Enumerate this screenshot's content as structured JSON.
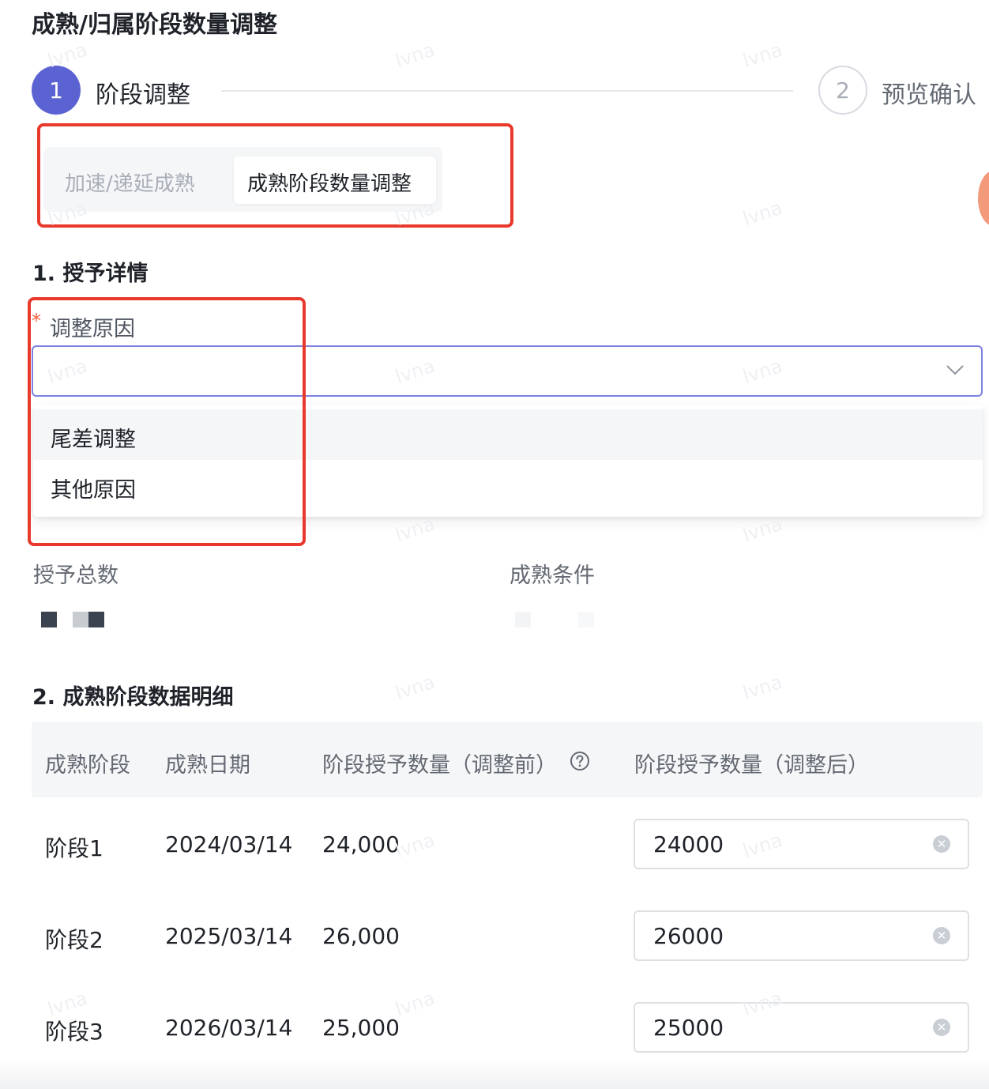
{
  "page": {
    "title": "成熟/归属阶段数量调整"
  },
  "steps": [
    {
      "number": "1",
      "label": "阶段调整",
      "state": "active"
    },
    {
      "number": "2",
      "label": "预览确认",
      "state": "pending"
    }
  ],
  "tabs": {
    "inactive": "加速/递延成熟",
    "active": "成熟阶段数量调整"
  },
  "section1": {
    "title": "1. 授予详情",
    "required_mark": "*",
    "reason_label": "调整原因",
    "reason_value": "",
    "reason_options": [
      "尾差调整",
      "其他原因"
    ]
  },
  "grant_info": {
    "total_label": "授予总数",
    "condition_label": "成熟条件"
  },
  "section2": {
    "title": "2. 成熟阶段数据明细",
    "headers": [
      "成熟阶段",
      "成熟日期",
      "阶段授予数量（调整前）",
      "阶段授予数量（调整后）"
    ],
    "rows": [
      {
        "stage": "阶段1",
        "date": "2024/03/14",
        "before": "24,000",
        "after": "24000"
      },
      {
        "stage": "阶段2",
        "date": "2025/03/14",
        "before": "26,000",
        "after": "26000"
      },
      {
        "stage": "阶段3",
        "date": "2026/03/14",
        "before": "25,000",
        "after": "25000"
      }
    ]
  },
  "watermark": "lvna",
  "colors": {
    "primary": "#5b63d3",
    "highlight": "#e8392c",
    "required": "#f5603f"
  }
}
